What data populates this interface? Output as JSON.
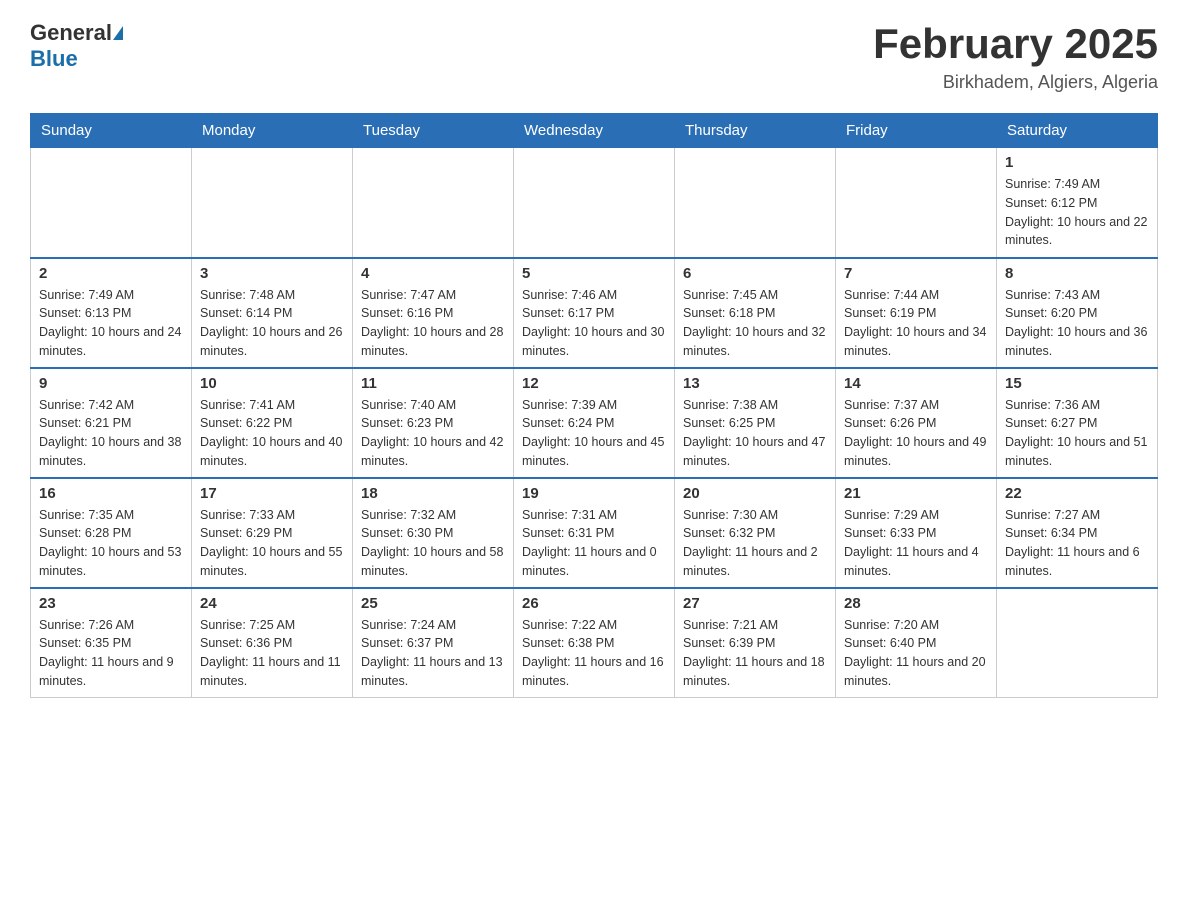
{
  "header": {
    "logo_general": "General",
    "logo_blue": "Blue",
    "month_title": "February 2025",
    "location": "Birkhadem, Algiers, Algeria"
  },
  "weekdays": [
    "Sunday",
    "Monday",
    "Tuesday",
    "Wednesday",
    "Thursday",
    "Friday",
    "Saturday"
  ],
  "weeks": [
    [
      {
        "day": "",
        "info": ""
      },
      {
        "day": "",
        "info": ""
      },
      {
        "day": "",
        "info": ""
      },
      {
        "day": "",
        "info": ""
      },
      {
        "day": "",
        "info": ""
      },
      {
        "day": "",
        "info": ""
      },
      {
        "day": "1",
        "info": "Sunrise: 7:49 AM\nSunset: 6:12 PM\nDaylight: 10 hours and 22 minutes."
      }
    ],
    [
      {
        "day": "2",
        "info": "Sunrise: 7:49 AM\nSunset: 6:13 PM\nDaylight: 10 hours and 24 minutes."
      },
      {
        "day": "3",
        "info": "Sunrise: 7:48 AM\nSunset: 6:14 PM\nDaylight: 10 hours and 26 minutes."
      },
      {
        "day": "4",
        "info": "Sunrise: 7:47 AM\nSunset: 6:16 PM\nDaylight: 10 hours and 28 minutes."
      },
      {
        "day": "5",
        "info": "Sunrise: 7:46 AM\nSunset: 6:17 PM\nDaylight: 10 hours and 30 minutes."
      },
      {
        "day": "6",
        "info": "Sunrise: 7:45 AM\nSunset: 6:18 PM\nDaylight: 10 hours and 32 minutes."
      },
      {
        "day": "7",
        "info": "Sunrise: 7:44 AM\nSunset: 6:19 PM\nDaylight: 10 hours and 34 minutes."
      },
      {
        "day": "8",
        "info": "Sunrise: 7:43 AM\nSunset: 6:20 PM\nDaylight: 10 hours and 36 minutes."
      }
    ],
    [
      {
        "day": "9",
        "info": "Sunrise: 7:42 AM\nSunset: 6:21 PM\nDaylight: 10 hours and 38 minutes."
      },
      {
        "day": "10",
        "info": "Sunrise: 7:41 AM\nSunset: 6:22 PM\nDaylight: 10 hours and 40 minutes."
      },
      {
        "day": "11",
        "info": "Sunrise: 7:40 AM\nSunset: 6:23 PM\nDaylight: 10 hours and 42 minutes."
      },
      {
        "day": "12",
        "info": "Sunrise: 7:39 AM\nSunset: 6:24 PM\nDaylight: 10 hours and 45 minutes."
      },
      {
        "day": "13",
        "info": "Sunrise: 7:38 AM\nSunset: 6:25 PM\nDaylight: 10 hours and 47 minutes."
      },
      {
        "day": "14",
        "info": "Sunrise: 7:37 AM\nSunset: 6:26 PM\nDaylight: 10 hours and 49 minutes."
      },
      {
        "day": "15",
        "info": "Sunrise: 7:36 AM\nSunset: 6:27 PM\nDaylight: 10 hours and 51 minutes."
      }
    ],
    [
      {
        "day": "16",
        "info": "Sunrise: 7:35 AM\nSunset: 6:28 PM\nDaylight: 10 hours and 53 minutes."
      },
      {
        "day": "17",
        "info": "Sunrise: 7:33 AM\nSunset: 6:29 PM\nDaylight: 10 hours and 55 minutes."
      },
      {
        "day": "18",
        "info": "Sunrise: 7:32 AM\nSunset: 6:30 PM\nDaylight: 10 hours and 58 minutes."
      },
      {
        "day": "19",
        "info": "Sunrise: 7:31 AM\nSunset: 6:31 PM\nDaylight: 11 hours and 0 minutes."
      },
      {
        "day": "20",
        "info": "Sunrise: 7:30 AM\nSunset: 6:32 PM\nDaylight: 11 hours and 2 minutes."
      },
      {
        "day": "21",
        "info": "Sunrise: 7:29 AM\nSunset: 6:33 PM\nDaylight: 11 hours and 4 minutes."
      },
      {
        "day": "22",
        "info": "Sunrise: 7:27 AM\nSunset: 6:34 PM\nDaylight: 11 hours and 6 minutes."
      }
    ],
    [
      {
        "day": "23",
        "info": "Sunrise: 7:26 AM\nSunset: 6:35 PM\nDaylight: 11 hours and 9 minutes."
      },
      {
        "day": "24",
        "info": "Sunrise: 7:25 AM\nSunset: 6:36 PM\nDaylight: 11 hours and 11 minutes."
      },
      {
        "day": "25",
        "info": "Sunrise: 7:24 AM\nSunset: 6:37 PM\nDaylight: 11 hours and 13 minutes."
      },
      {
        "day": "26",
        "info": "Sunrise: 7:22 AM\nSunset: 6:38 PM\nDaylight: 11 hours and 16 minutes."
      },
      {
        "day": "27",
        "info": "Sunrise: 7:21 AM\nSunset: 6:39 PM\nDaylight: 11 hours and 18 minutes."
      },
      {
        "day": "28",
        "info": "Sunrise: 7:20 AM\nSunset: 6:40 PM\nDaylight: 11 hours and 20 minutes."
      },
      {
        "day": "",
        "info": ""
      }
    ]
  ]
}
